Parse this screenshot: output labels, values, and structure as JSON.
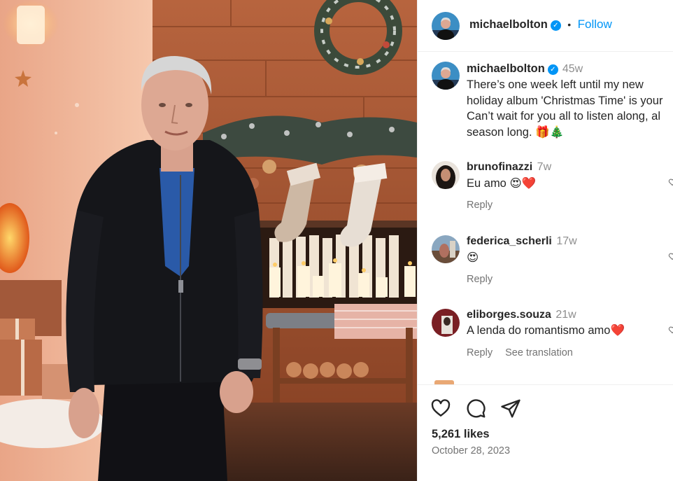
{
  "post": {
    "author": "michaelbolton",
    "verified_mark": "✓",
    "separator": "•",
    "follow_label": "Follow"
  },
  "caption": {
    "username": "michaelbolton",
    "time": "45w",
    "text": "There’s one week left until my new\nholiday album 'Christmas Time' is your\nCan’t wait for you all to listen along, al\nseason long. 🎁🎄"
  },
  "comments": [
    {
      "username": "brunofinazzi",
      "time": "7w",
      "text": "Eu amo 😍❤️",
      "reply_label": "Reply"
    },
    {
      "username": "federica_scherli",
      "time": "17w",
      "text": "😍",
      "reply_label": "Reply"
    },
    {
      "username": "eliborges.souza",
      "time": "21w",
      "text": "A lenda do romantismo amo❤️",
      "reply_label": "Reply",
      "translation_label": "See translation"
    }
  ],
  "footer": {
    "likes": "5,261 likes",
    "date": "October 28, 2023"
  },
  "icons": {
    "like": "heart-icon",
    "comment": "comment-bubble-icon",
    "share": "paper-plane-icon",
    "comment_like": "heart-icon-small"
  },
  "colors": {
    "accent": "#0095f6",
    "text": "#262626",
    "secondary": "#737373"
  }
}
